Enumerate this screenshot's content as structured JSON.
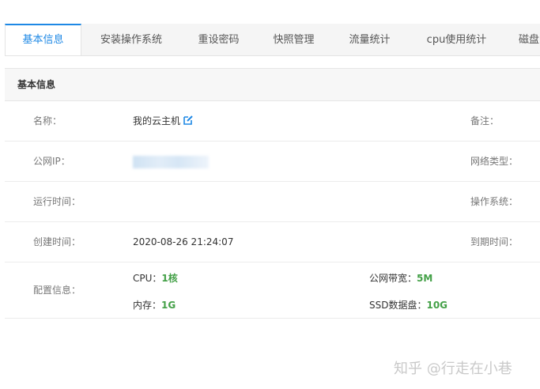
{
  "tabs": [
    {
      "label": "基本信息",
      "active": true
    },
    {
      "label": "安装操作系统",
      "active": false
    },
    {
      "label": "重设密码",
      "active": false
    },
    {
      "label": "快照管理",
      "active": false
    },
    {
      "label": "流量统计",
      "active": false
    },
    {
      "label": "cpu使用统计",
      "active": false
    },
    {
      "label": "磁盘",
      "active": false
    }
  ],
  "section": {
    "title": "基本信息"
  },
  "rows": {
    "name": {
      "label": "名称：",
      "value": "我的云主机",
      "right_label": "备注："
    },
    "ip": {
      "label": "公网IP：",
      "right_label": "网络类型："
    },
    "runtime": {
      "label": "运行时间：",
      "right_label": "操作系统："
    },
    "created": {
      "label": "创建时间：",
      "value": "2020-08-26 21:24:07",
      "right_label": "到期时间："
    },
    "config": {
      "label": "配置信息：",
      "cpu_label": "CPU：",
      "cpu_value": "1核",
      "bandwidth_label": "公网带宽：",
      "bandwidth_value": "5M",
      "memory_label": "内存：",
      "memory_value": "1G",
      "disk_label": "SSD数据盘：",
      "disk_value": "10G"
    }
  },
  "watermark": "知乎 @行走在小巷",
  "colors": {
    "accent": "#1e88e5",
    "value_green": "#43a047"
  }
}
